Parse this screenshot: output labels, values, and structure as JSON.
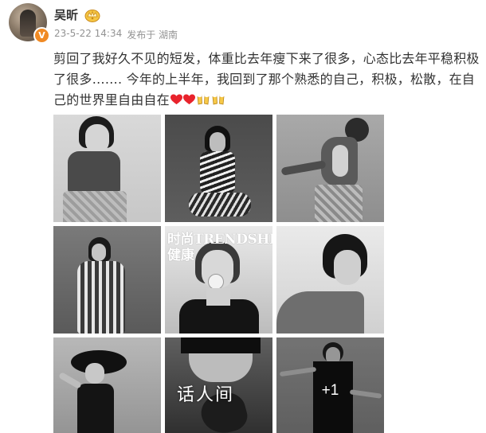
{
  "author": {
    "name": "吴昕",
    "badge_icon": "crown-icon",
    "verified": true,
    "verified_icon": "verified-v-icon"
  },
  "meta": {
    "timestamp": "23-5-22 14:34",
    "source": "发布于 湖南"
  },
  "post": {
    "text": "剪回了我好久不见的短发，体重比去年瘦下来了很多，心态比去年平稳积极了很多……. 今年的上半年，我回到了那个熟悉的自己，积极，松散，在自己的世界里自由自在",
    "emojis": [
      "heart-emoji",
      "heart-emoji",
      "cheers-emoji",
      "cheers-emoji"
    ]
  },
  "photos": {
    "magazine_cover_title_line1": "时尚TRENDSHEALTH",
    "magazine_cover_title_line2": "健康",
    "more_count": "+1"
  },
  "watermark": "话人间",
  "colors": {
    "text": "#333333",
    "meta": "#939393",
    "verified": "#f08a24",
    "heart": "#e8232c"
  }
}
